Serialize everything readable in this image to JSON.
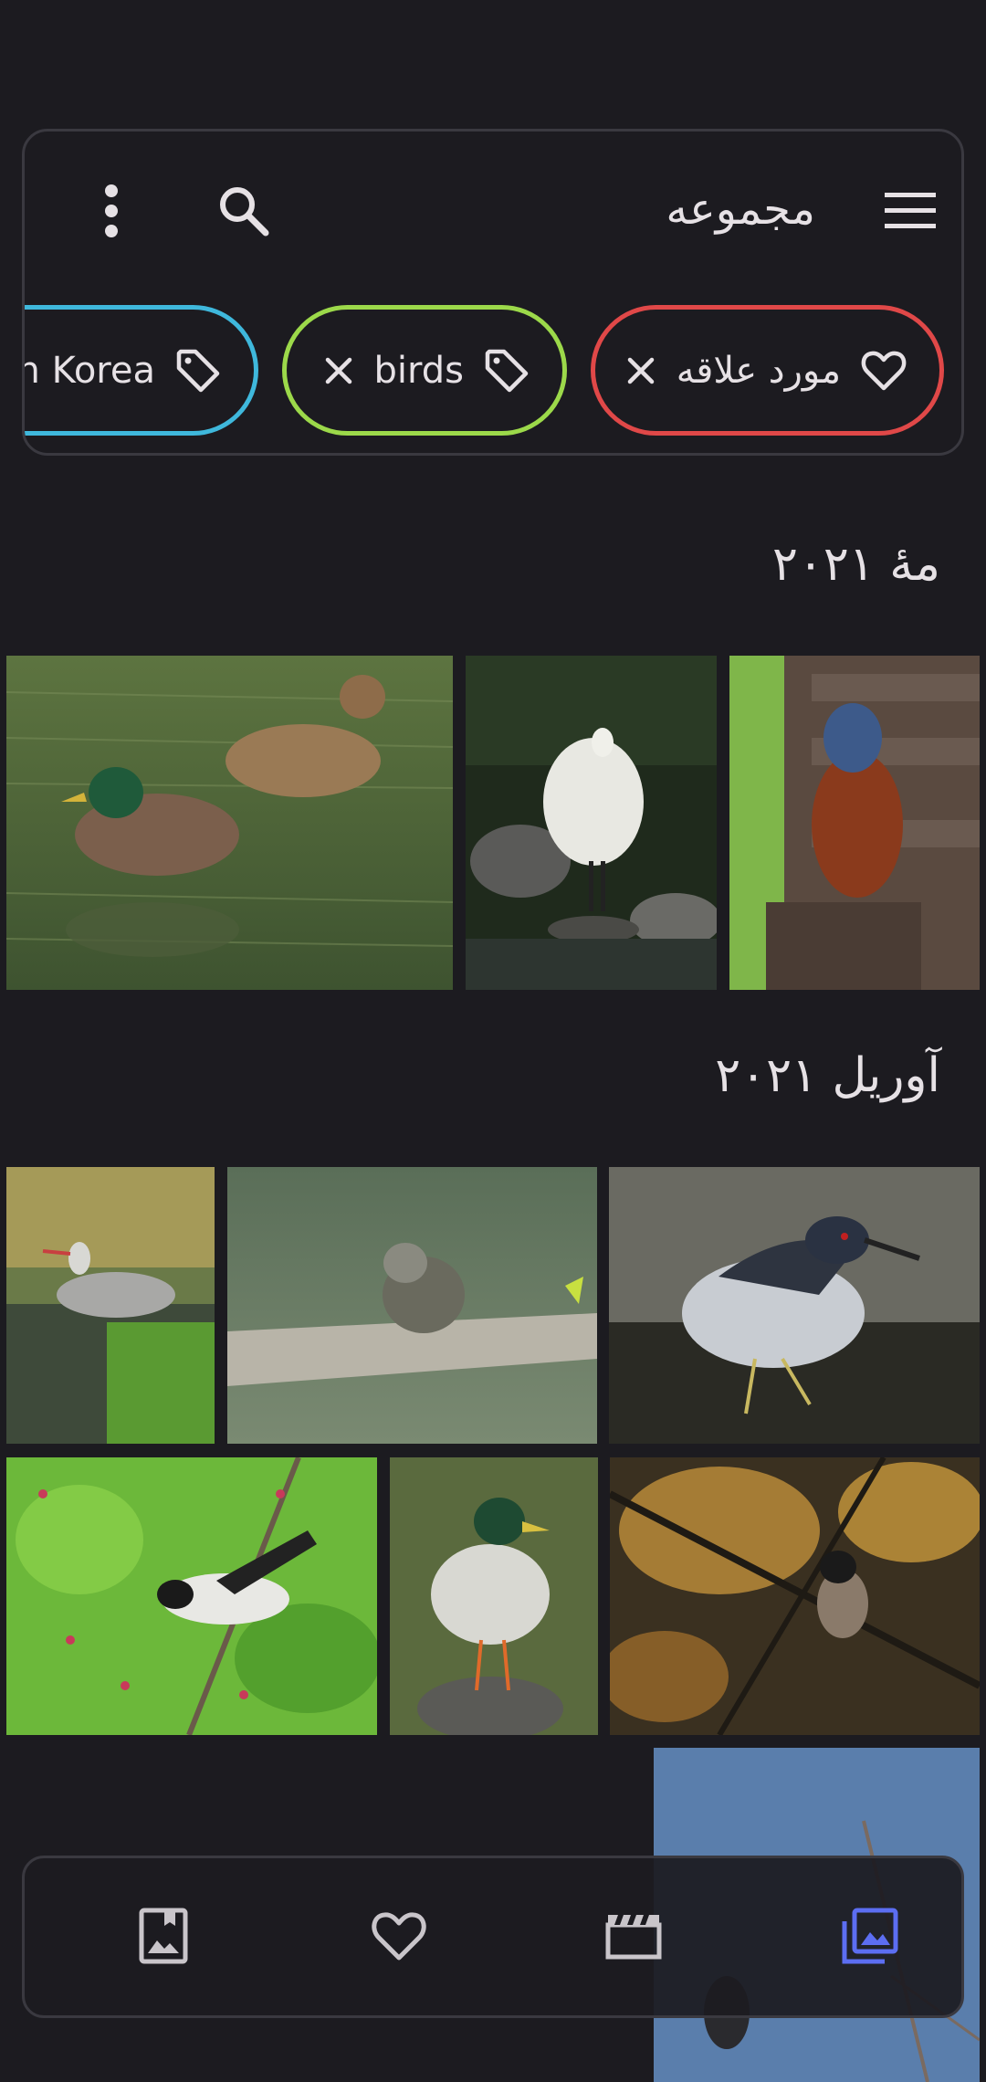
{
  "header": {
    "title": "مجموعه",
    "more_icon": "more-vert-icon",
    "search_icon": "search-icon",
    "menu_icon": "menu-icon"
  },
  "chips": [
    {
      "label": "مورد علاقه",
      "icon": "heart-icon",
      "color": "#e04848"
    },
    {
      "label": "birds",
      "icon": "tag-icon",
      "color": "#9cd94a"
    },
    {
      "label": "h Korea",
      "icon": "tag-icon",
      "color": "#3fb8dc"
    }
  ],
  "sections": [
    {
      "title": "مهٔ ۲۰۲۱",
      "photos": [
        "mallard-ducks",
        "white-egret",
        "blue-rock-thrush"
      ]
    },
    {
      "title": "آوریل ۲۰۲۱",
      "photos": [
        "grey-heron",
        "juvenile-bird-on-branch",
        "night-heron",
        "tit-on-blossom-branch",
        "mallard-on-rock",
        "bird-in-autumn-tree",
        "bird-on-blue-sky"
      ]
    }
  ],
  "bottom_nav": [
    {
      "icon": "album-icon",
      "active": false
    },
    {
      "icon": "favorite-icon",
      "active": false
    },
    {
      "icon": "video-icon",
      "active": false
    },
    {
      "icon": "gallery-icon",
      "active": true
    }
  ],
  "colors": {
    "background": "#1c1b20",
    "border": "#3a3940",
    "icon": "#e6e1e5",
    "nav_icon": "#c9c5ca",
    "accent": "#5c6ef2"
  }
}
